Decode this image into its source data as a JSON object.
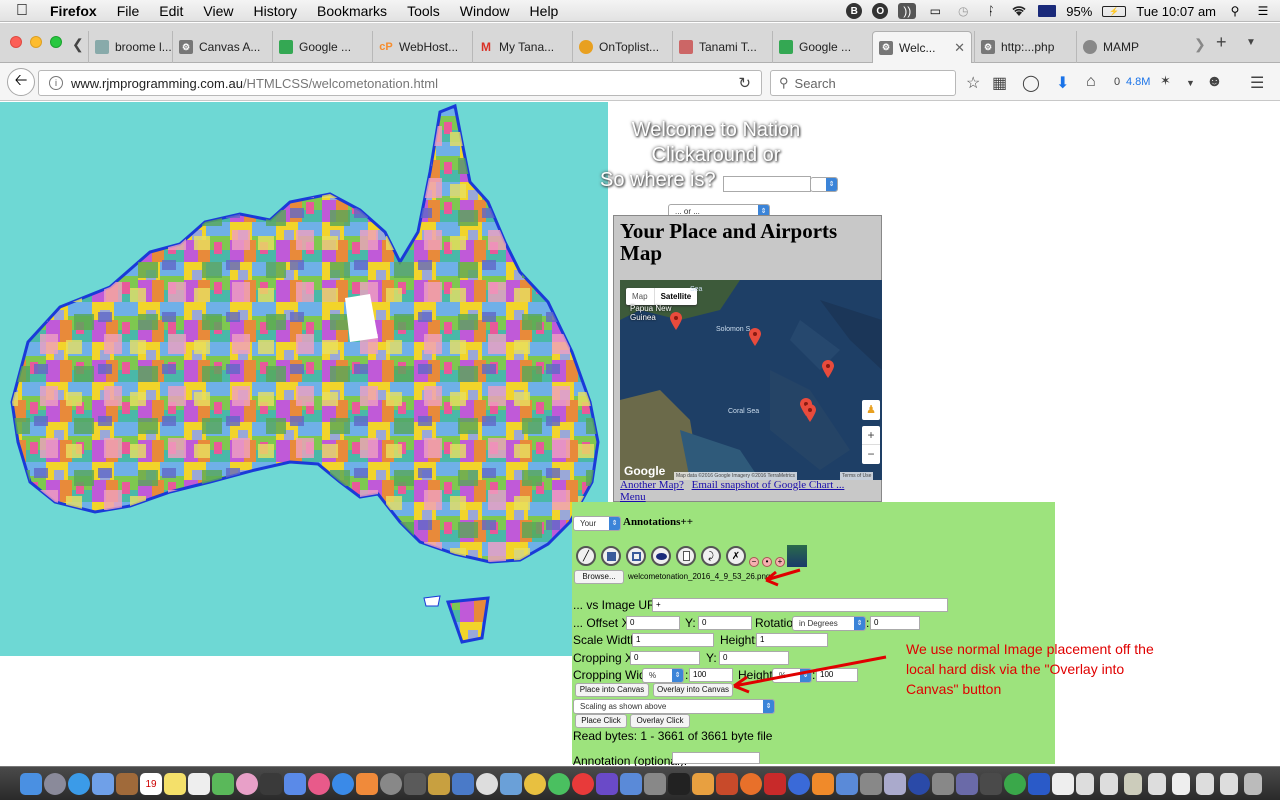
{
  "menubar": {
    "app": "Firefox",
    "items": [
      "File",
      "Edit",
      "View",
      "History",
      "Bookmarks",
      "Tools",
      "Window",
      "Help"
    ],
    "battery": "95%",
    "clock": "Tue 10:07 am"
  },
  "tabs": [
    {
      "label": "broome l...",
      "icon": "globe-icon"
    },
    {
      "label": "Canvas A...",
      "icon": "gear-icon"
    },
    {
      "label": "Google ...",
      "icon": "google-maps-icon"
    },
    {
      "label": "WebHost...",
      "icon": "cpanel-icon"
    },
    {
      "label": "My Tana...",
      "icon": "gmail-icon"
    },
    {
      "label": "OnToplist...",
      "icon": "ontoplist-icon"
    },
    {
      "label": "Tanami T...",
      "icon": "page-icon"
    },
    {
      "label": "Google ...",
      "icon": "google-maps-icon"
    },
    {
      "label": "Welc...",
      "icon": "gear-icon",
      "active": true
    },
    {
      "label": "http:...php",
      "icon": "gear-icon"
    },
    {
      "label": "MAMP",
      "icon": "globe-icon"
    }
  ],
  "nav": {
    "url_host": "www.rjmprogramming.com.au",
    "url_path": "/HTMLCSS/welcometonation.html",
    "search_placeholder": "Search",
    "download_count": "0",
    "download_size": "4.8M"
  },
  "page": {
    "title_lines": [
      "Welcome to Nation",
      "Clickaround or",
      "So where is?"
    ],
    "or_select": "... or ...",
    "map_panel_title": "Your Place and Airports Map",
    "map_type_map": "Map",
    "map_type_satellite": "Satellite",
    "map_labels": [
      "Papua New Guinea",
      "Solomon S...",
      "Coral Sea",
      "Sea"
    ],
    "google_logo": "Google",
    "map_attribution": "Map data ©2016 Google Imagery ©2016 TerraMetrics",
    "terms": "Terms of Use",
    "zoom_in": "+",
    "zoom_out": "−",
    "links": [
      "Another Map?",
      "Email snapshot of Google Chart ...",
      "Menu"
    ]
  },
  "annotations": {
    "your_select": "Your",
    "heading": "Annotations++",
    "browse_label": "Browse...",
    "filename": "welcometonation_2016_4_9_53_26.png",
    "image_url_label": "... vs Image URL:",
    "image_url_value": "+",
    "offset_x_label": "... Offset X:",
    "offset_x": "0",
    "y_label": "Y:",
    "offset_y": "0",
    "rotation_label": "Rotation",
    "rotation_unit": "in Degrees",
    "rotation_value": "0",
    "scale_width_label": "Scale Width:",
    "scale_width": "1",
    "height_label": "Height:",
    "scale_height": "1",
    "crop_x_label": "Cropping X:",
    "crop_x": "0",
    "crop_y_label": "Y:",
    "crop_y": "0",
    "crop_width_label": "Cropping Width",
    "crop_width_unit": "%",
    "crop_width": "100",
    "crop_height_label": "Height",
    "crop_height_unit": "%",
    "crop_height": "100",
    "place_into_canvas": "Place into Canvas",
    "overlay_into_canvas": "Overlay into Canvas",
    "scaling_select": "Scaling as shown above",
    "place_click": "Place Click",
    "overlay_click": "Overlay Click",
    "read_bytes": "Read bytes: 1 - 3661 of 3661 byte file",
    "annotation_label": "Annotation (optional):"
  },
  "callout_note": "We use normal Image placement off the local hard disk via the \"Overlay into Canvas\" button",
  "colors": {
    "ocean": "#6ed8d4",
    "annotation_bg": "#9de37d",
    "callout_red": "#e00000",
    "link_blue": "#1a0dab"
  }
}
